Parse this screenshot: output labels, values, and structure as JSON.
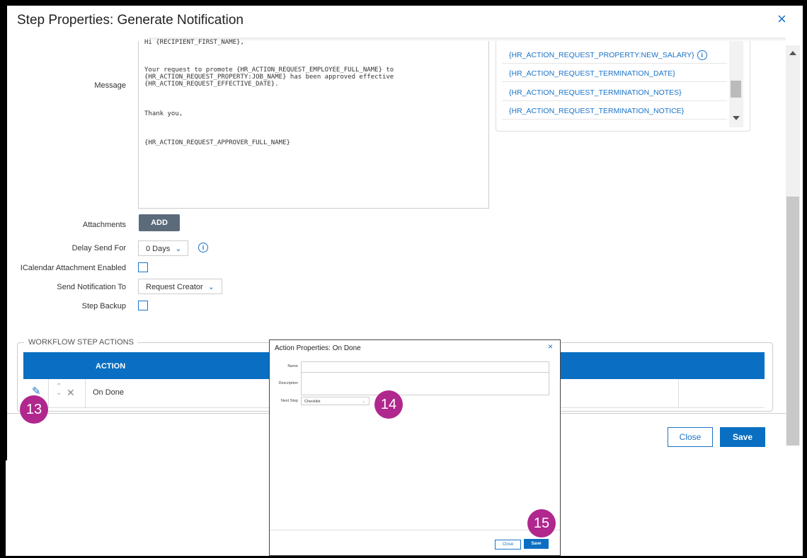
{
  "dialog": {
    "title": "Step Properties: Generate Notification",
    "close_icon": "×"
  },
  "message": {
    "label": "Message",
    "lines": [
      "Hi {RECIPIENT_FIRST_NAME},",
      "Your request to promote {HR_ACTION_REQUEST_EMPLOYEE_FULL_NAME} to",
      "{HR_ACTION_REQUEST_PROPERTY:JOB_NAME} has been approved effective",
      "{HR_ACTION_REQUEST_EFFECTIVE_DATE}.",
      "Thank you,",
      "{HR_ACTION_REQUEST_APPROVER_FULL_NAME}"
    ]
  },
  "tokens": [
    "{HR_ACTION_REQUEST_PROPERTY:NEW_SALARY}",
    "{HR_ACTION_REQUEST_TERMINATION_DATE}",
    "{HR_ACTION_REQUEST_TERMINATION_NOTES}",
    "{HR_ACTION_REQUEST_TERMINATION_NOTICE}"
  ],
  "form": {
    "attachments_label": "Attachments",
    "add_button": "ADD",
    "delay_label": "Delay Send For",
    "delay_value": "0 Days",
    "icalendar_label": "ICalendar Attachment Enabled",
    "send_to_label": "Send Notification To",
    "send_to_value": "Request Creator",
    "step_backup_label": "Step Backup",
    "chevron": "⌄"
  },
  "workflow": {
    "legend": "WORKFLOW STEP ACTIONS",
    "column_action": "ACTION",
    "rows": [
      {
        "action": "On Done"
      }
    ]
  },
  "footer": {
    "close": "Close",
    "save": "Save"
  },
  "action_dialog": {
    "title": "Action Properties: On Done",
    "close_icon": "×",
    "name_label": "Name",
    "name_value": "",
    "description_label": "Description",
    "description_value": "",
    "next_step_label": "Next Step",
    "next_step_value": "Checklist",
    "close": "Close",
    "save": "Save"
  },
  "badges": [
    "13",
    "14",
    "15"
  ],
  "colors": {
    "accent": "#0a6fc2",
    "link": "#1a73c8",
    "badge": "#b0278d"
  }
}
